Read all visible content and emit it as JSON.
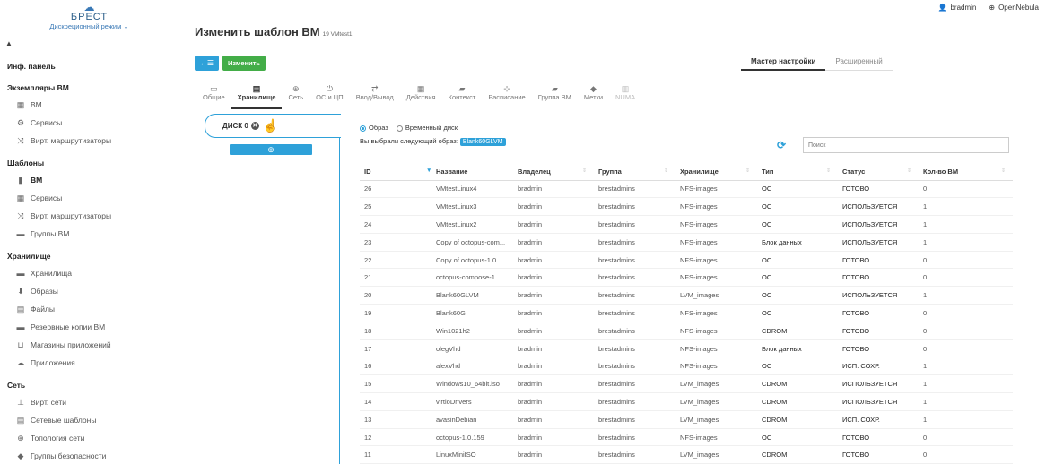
{
  "branding": {
    "logo": "☁",
    "name": "БРЕСТ",
    "mode": "Дискреционный режим"
  },
  "user": {
    "name": "bradmin",
    "zone": "OpenNebula"
  },
  "nav": {
    "sections": [
      {
        "label": "Инф. панель",
        "items": []
      },
      {
        "label": "Экземпляры ВМ",
        "items": [
          {
            "label": "ВМ",
            "icon": "▦"
          },
          {
            "label": "Сервисы",
            "icon": "⚙"
          },
          {
            "label": "Вирт. маршрутизаторы",
            "icon": "⤨"
          }
        ]
      },
      {
        "label": "Шаблоны",
        "items": [
          {
            "label": "ВМ",
            "icon": "▮",
            "active": true
          },
          {
            "label": "Сервисы",
            "icon": "▦"
          },
          {
            "label": "Вирт. маршрутизаторы",
            "icon": "⤨"
          },
          {
            "label": "Группы ВМ",
            "icon": "▬"
          }
        ]
      },
      {
        "label": "Хранилище",
        "items": [
          {
            "label": "Хранилища",
            "icon": "▬"
          },
          {
            "label": "Образы",
            "icon": "⬇"
          },
          {
            "label": "Файлы",
            "icon": "▤"
          },
          {
            "label": "Резервные копии ВМ",
            "icon": "▬"
          },
          {
            "label": "Магазины приложений",
            "icon": "⊔"
          },
          {
            "label": "Приложения",
            "icon": "☁"
          }
        ]
      },
      {
        "label": "Сеть",
        "items": [
          {
            "label": "Вирт. сети",
            "icon": "⊥"
          },
          {
            "label": "Сетевые шаблоны",
            "icon": "▤"
          },
          {
            "label": "Топология сети",
            "icon": "⊕"
          },
          {
            "label": "Группы безопасности",
            "icon": "◆"
          }
        ]
      }
    ]
  },
  "page": {
    "title": "Изменить шаблон ВМ",
    "subtitle": "19 VMtest1"
  },
  "toolbar": {
    "back_icon": "←☰",
    "save_label": "Изменить"
  },
  "mode_tabs": {
    "wizard": "Мастер настройки",
    "advanced": "Расширенный"
  },
  "section_tabs": [
    {
      "label": "Общие",
      "icon": "▭"
    },
    {
      "label": "Хранилище",
      "icon": "▤",
      "active": true
    },
    {
      "label": "Сеть",
      "icon": "⊕"
    },
    {
      "label": "ОС и ЦП",
      "icon": "⏻"
    },
    {
      "label": "Ввод/Вывод",
      "icon": "⇄"
    },
    {
      "label": "Действия",
      "icon": "▦"
    },
    {
      "label": "Контекст",
      "icon": "▰"
    },
    {
      "label": "Расписание",
      "icon": "⊹"
    },
    {
      "label": "Группа ВМ",
      "icon": "▰"
    },
    {
      "label": "Метки",
      "icon": "◆"
    },
    {
      "label": "NUMA",
      "icon": "▥",
      "disabled": true
    }
  ],
  "disk": {
    "tab_label": "ДИСК 0",
    "add_icon": "⊕"
  },
  "image_select": {
    "option_image": "Образ",
    "option_volatile": "Временный диск",
    "selected_prefix": "Вы выбрали следующий образ:",
    "selected_value": "Blank60GLVM",
    "search_placeholder": "Поиск"
  },
  "table": {
    "headers": [
      "ID",
      "Название",
      "Владелец",
      "Группа",
      "Хранилище",
      "Тип",
      "Статус",
      "Кол-во ВМ"
    ],
    "rows": [
      [
        "26",
        "VMtestLinux4",
        "bradmin",
        "brestadmins",
        "NFS-images",
        "OC",
        "ГОТОВО",
        "0"
      ],
      [
        "25",
        "VMtestLinux3",
        "bradmin",
        "brestadmins",
        "NFS-images",
        "OC",
        "ИСПОЛЬЗУЕТСЯ",
        "1"
      ],
      [
        "24",
        "VMtestLinux2",
        "bradmin",
        "brestadmins",
        "NFS-images",
        "OC",
        "ИСПОЛЬЗУЕТСЯ",
        "1"
      ],
      [
        "23",
        "Copy of octopus-com...",
        "bradmin",
        "brestadmins",
        "NFS-images",
        "Блок данных",
        "ИСПОЛЬЗУЕТСЯ",
        "1"
      ],
      [
        "22",
        "Copy of octopus-1.0...",
        "bradmin",
        "brestadmins",
        "NFS-images",
        "OC",
        "ГОТОВО",
        "0"
      ],
      [
        "21",
        "octopus-compose-1...",
        "bradmin",
        "brestadmins",
        "NFS-images",
        "OC",
        "ГОТОВО",
        "0"
      ],
      [
        "20",
        "Blank60GLVM",
        "bradmin",
        "brestadmins",
        "LVM_images",
        "OC",
        "ИСПОЛЬЗУЕТСЯ",
        "1"
      ],
      [
        "19",
        "Blank60G",
        "bradmin",
        "brestadmins",
        "NFS-images",
        "OC",
        "ГОТОВО",
        "0"
      ],
      [
        "18",
        "Win1021h2",
        "bradmin",
        "brestadmins",
        "NFS-images",
        "CDROM",
        "ГОТОВО",
        "0"
      ],
      [
        "17",
        "olegVhd",
        "bradmin",
        "brestadmins",
        "NFS-images",
        "Блок данных",
        "ГОТОВО",
        "0"
      ],
      [
        "16",
        "alexVhd",
        "bradmin",
        "brestadmins",
        "NFS-images",
        "OC",
        "ИСП. СОХР.",
        "1"
      ],
      [
        "15",
        "Windows10_64bit.iso",
        "bradmin",
        "brestadmins",
        "LVM_images",
        "CDROM",
        "ИСПОЛЬЗУЕТСЯ",
        "1"
      ],
      [
        "14",
        "virtioDrivers",
        "bradmin",
        "brestadmins",
        "LVM_images",
        "CDROM",
        "ИСПОЛЬЗУЕТСЯ",
        "1"
      ],
      [
        "13",
        "avasinDebian",
        "bradmin",
        "brestadmins",
        "LVM_images",
        "CDROM",
        "ИСП. СОХР.",
        "1"
      ],
      [
        "12",
        "octopus-1.0.159",
        "bradmin",
        "brestadmins",
        "NFS-images",
        "OC",
        "ГОТОВО",
        "0"
      ],
      [
        "11",
        "LinuxMiniISO",
        "bradmin",
        "brestadmins",
        "LVM_images",
        "CDROM",
        "ГОТОВО",
        "0"
      ]
    ]
  }
}
